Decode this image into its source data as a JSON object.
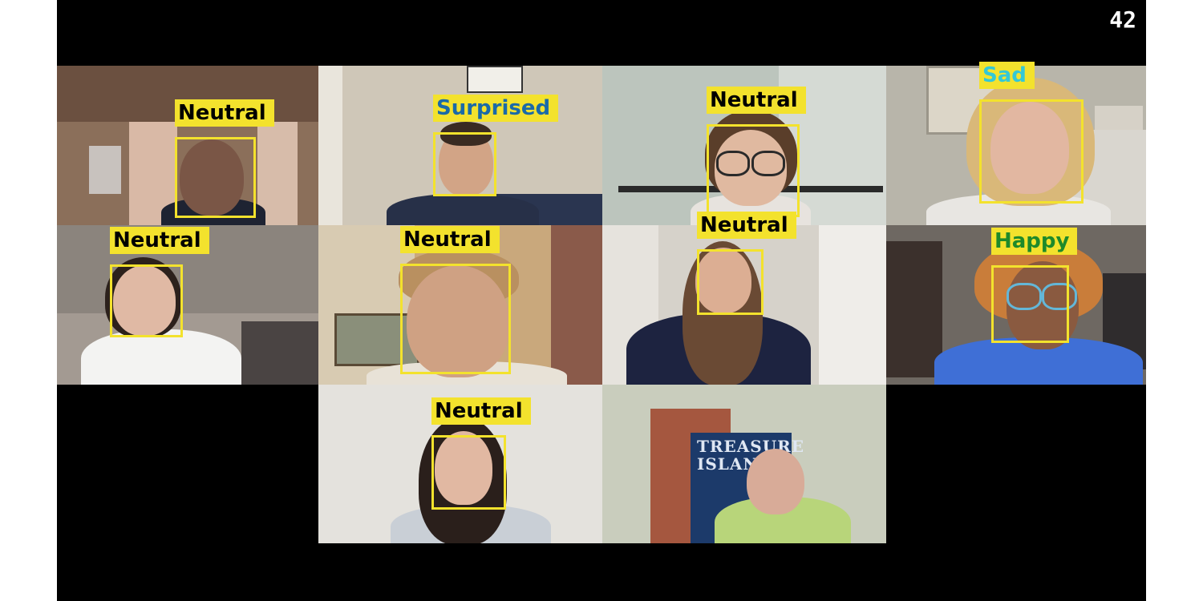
{
  "frame_counter": "42",
  "tiles": [
    {
      "label": "Neutral",
      "emotion": "neutral"
    },
    {
      "label": "Surprised",
      "emotion": "surprised"
    },
    {
      "label": "Neutral",
      "emotion": "neutral"
    },
    {
      "label": "Sad",
      "emotion": "sad"
    },
    {
      "label": "Neutral",
      "emotion": "neutral"
    },
    {
      "label": "Neutral",
      "emotion": "neutral"
    },
    {
      "label": "Neutral",
      "emotion": "neutral"
    },
    {
      "label": "Happy",
      "emotion": "happy"
    },
    {
      "label": "Neutral",
      "emotion": "neutral"
    },
    {
      "label": "",
      "emotion": ""
    }
  ],
  "poster_text": "TREASURE ISLAND",
  "colors": {
    "box": "#f3e22d",
    "neutral_text": "#000000",
    "surprised_text": "#1a6aa8",
    "sad_text": "#34c8d6",
    "happy_text": "#1e8a2a",
    "background": "#000000"
  }
}
